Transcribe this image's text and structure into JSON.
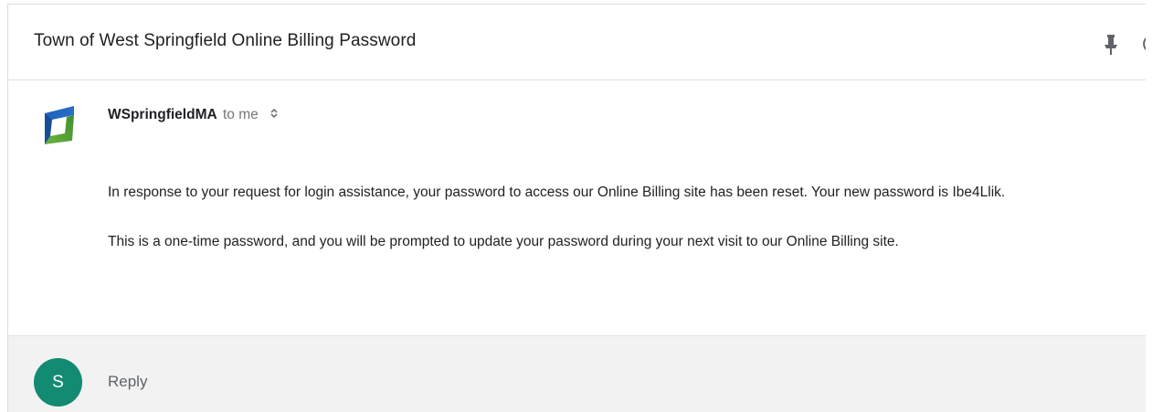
{
  "email": {
    "subject": "Town of West Springfield Online Billing Password",
    "sender_name": "WSpringfieldMA",
    "recipient_text": "to me",
    "body": {
      "paragraph_1": "In response to your request for login assistance, your password to access our Online Billing site has been reset. Your new password is Ibe4Llik.",
      "paragraph_2": "This is a one-time password, and you will be prompted to update your password during your next visit to our Online Billing site."
    }
  },
  "reply": {
    "avatar_initial": "S",
    "label": "Reply"
  },
  "icons": {
    "pin": "pin-icon",
    "more": "more-icon",
    "expand": "expand-details-icon",
    "sender_logo": "sender-logo-icon"
  },
  "colors": {
    "reply_avatar": "#138a72",
    "logo_blue": "#1f5fb4",
    "logo_green": "#6cb33f"
  }
}
